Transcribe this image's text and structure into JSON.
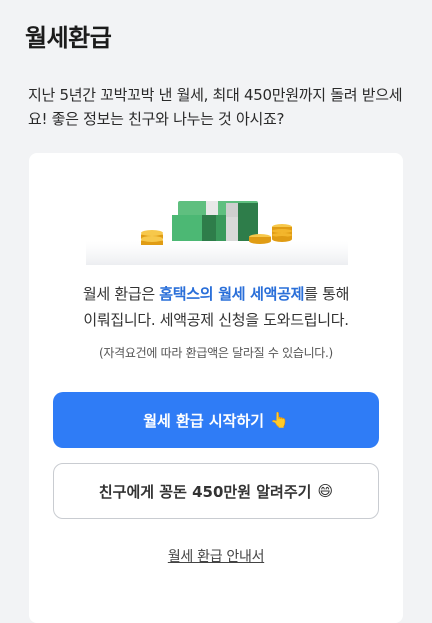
{
  "page": {
    "title": "월세환급",
    "intro": "지난 5년간 꼬박꼬박 낸 월세, 최대 450만원까지 돌려 받으세요! 좋은 정보는 친구와 나누는 것 아시죠?"
  },
  "card": {
    "illustration_icon": "money-stack-icon",
    "desc_part1": "월세 환급은 ",
    "desc_em1": "홈택스의 월세 세액공제",
    "desc_part2": "를 통해",
    "desc_line2": "이뤄집니다. 세액공제 신청을 도와드립니다.",
    "note": "(자격요건에 따라 환급액은 달라질 수 있습니다.)",
    "primary_button": "월세 환급 시작하기",
    "primary_button_emoji": "👆",
    "secondary_button": "친구에게 꽁돈 450만원 알려주기",
    "secondary_button_emoji": "😄",
    "guide_link": "월세 환급 안내서"
  },
  "colors": {
    "accent": "#2f7cf6",
    "highlight_text": "#2a6fd9",
    "background": "#f2f3f5",
    "money_green": "#3a9a5c",
    "coin_gold": "#f3b62c"
  }
}
